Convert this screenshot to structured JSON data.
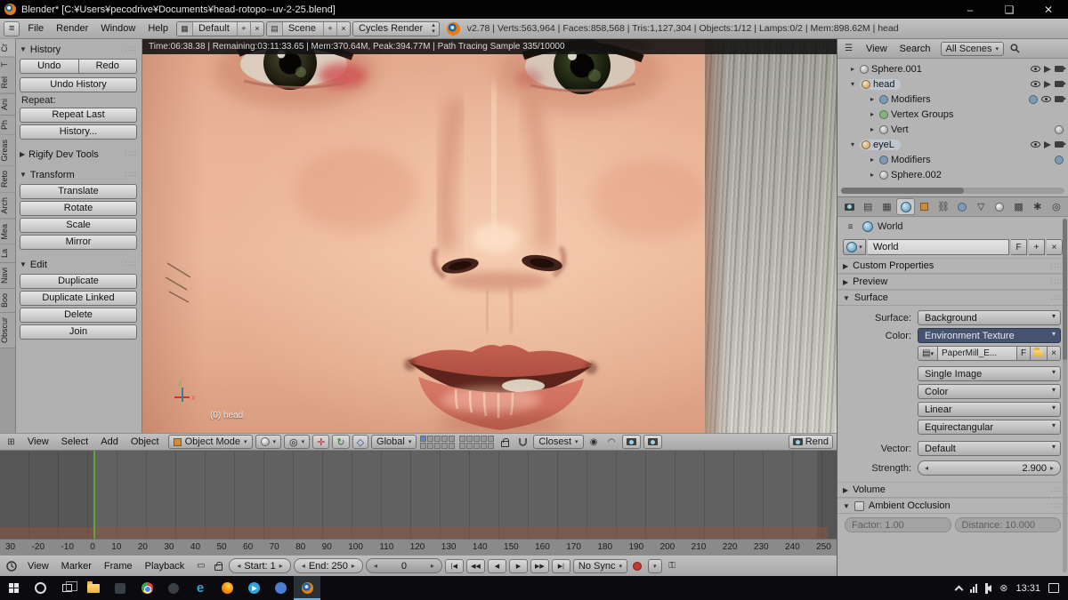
{
  "window": {
    "title": "Blender* [C:¥Users¥pecodrive¥Documents¥head-rotopo--uv-2-25.blend]",
    "minimize": "–",
    "maximize": "❑",
    "close": "✕"
  },
  "info_bar": {
    "menus": [
      "File",
      "Render",
      "Window",
      "Help"
    ],
    "layout": "Default",
    "scene": "Scene",
    "engine": "Cycles Render",
    "stats": "v2.78 | Verts:563,964 | Faces:858,568 | Tris:1,127,304 | Objects:1/12 | Lamps:0/2 | Mem:898.62M | head"
  },
  "tool_shelf": {
    "tabs": [
      "Cr",
      "T",
      "Rel",
      "Ani",
      "Ph",
      "Greas",
      "Reto",
      "Arch",
      "Mea",
      "La",
      "Navi",
      "Boo",
      "Obscur"
    ],
    "panels": {
      "history": "History",
      "rigify": "Rigify Dev Tools",
      "transform": "Transform",
      "edit": "Edit"
    },
    "history_buttons": {
      "undo": "Undo",
      "redo": "Redo",
      "undo_history": "Undo History",
      "repeat_label": "Repeat:",
      "repeat_last": "Repeat Last",
      "history": "History..."
    },
    "transform_buttons": [
      "Translate",
      "Rotate",
      "Scale",
      "Mirror"
    ],
    "edit_buttons": [
      "Duplicate",
      "Duplicate Linked",
      "Delete",
      "Join"
    ]
  },
  "viewport": {
    "render_stats": "Time:06:38.38 | Remaining:03:11:33.65 | Mem:370.64M, Peak:394.77M | Path Tracing Sample 335/10000",
    "view_label": "(0) head",
    "header": {
      "menus": [
        "View",
        "Select",
        "Add",
        "Object"
      ],
      "mode": "Object Mode",
      "orientation": "Global",
      "snap_target": "Closest",
      "render_label": "Rend"
    }
  },
  "outliner": {
    "menus": [
      "View",
      "Search"
    ],
    "scope": "All Scenes",
    "items": [
      {
        "label": "Sphere.001"
      },
      {
        "label": "head"
      },
      {
        "label": "Modifiers"
      },
      {
        "label": "Vertex Groups"
      },
      {
        "label": "Vert"
      },
      {
        "label": "eyeL"
      },
      {
        "label": "Modifiers"
      },
      {
        "label": "Sphere.002"
      }
    ]
  },
  "properties": {
    "breadcrumb": "World",
    "datablock_name": "World",
    "fake_user": "F",
    "panels": {
      "custom_properties": "Custom Properties",
      "preview": "Preview",
      "surface": "Surface",
      "volume": "Volume",
      "ambient_occlusion": "Ambient Occlusion"
    },
    "surface": {
      "surface_label": "Surface:",
      "surface_value": "Background",
      "color_label": "Color:",
      "color_value": "Environment Texture",
      "image_name": "PaperMill_E...",
      "image_fake_user": "F",
      "source": "Single Image",
      "color_space": "Color",
      "interpolation": "Linear",
      "projection": "Equirectangular",
      "vector_label": "Vector:",
      "vector_value": "Default",
      "strength_label": "Strength:",
      "strength_value": "2.900"
    },
    "ao_factor": "Factor: 1.00",
    "ao_distance": "Distance: 10.000"
  },
  "timeline": {
    "frame_labels": [
      "30",
      "-20",
      "-10",
      "0",
      "10",
      "20",
      "30",
      "40",
      "50",
      "60",
      "70",
      "80",
      "90",
      "100",
      "110",
      "120",
      "130",
      "140",
      "150",
      "160",
      "170",
      "180",
      "190",
      "200",
      "210",
      "220",
      "230",
      "240",
      "250"
    ],
    "header": {
      "menus": [
        "View",
        "Marker",
        "Frame",
        "Playback"
      ],
      "start": "Start: 1",
      "end": "End: 250",
      "current": "0",
      "sync": "No Sync"
    }
  },
  "taskbar": {
    "time": "13:31"
  },
  "colors": {
    "header_gray": "#b4b4b4",
    "selected_enum": "#46536f",
    "playhead_green": "#63a436",
    "blender_orange": "#e87d0d"
  }
}
